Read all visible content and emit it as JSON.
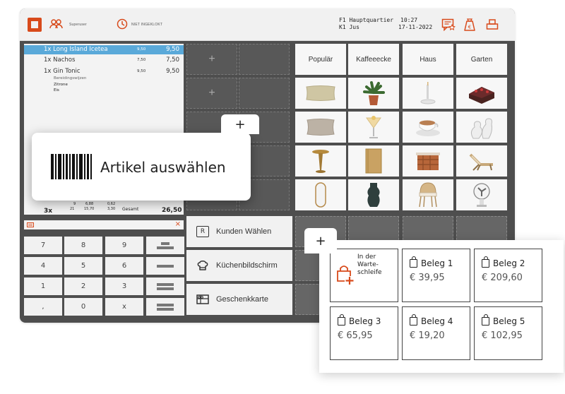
{
  "topbar": {
    "user_label": "Superuser",
    "clock_label": "NIET INGEKLOKT",
    "location_line1": "F1 Hauptquartier",
    "location_line2": "K1 Jus",
    "time": "10:27",
    "date": "17-11-2022"
  },
  "order": {
    "items": [
      {
        "qty": "1x",
        "name": "Long Island Icetea",
        "price": "9,50",
        "total": "9,50",
        "selected": true
      },
      {
        "qty": "1x",
        "name": "Nachos",
        "price": "7,50",
        "total": "7,50",
        "selected": false
      },
      {
        "qty": "1x",
        "name": "Gin Tonic",
        "price": "9,50",
        "total": "9,50",
        "selected": false
      }
    ],
    "modifier_caption": "Bereidingswijzen",
    "modifiers": [
      "Zitrone",
      "Eis"
    ],
    "summary": {
      "count": "3x",
      "col1_top": "9",
      "col1_bottom": "21",
      "col2_top": "6,88",
      "col2_bottom": "15,70",
      "col3_top": "0,62",
      "col3_bottom": "3,30",
      "total_label": "Gesamt",
      "total": "26,50"
    }
  },
  "keypad": {
    "keys": [
      "7",
      "8",
      "9",
      "4",
      "5",
      "6",
      "1",
      "2",
      "3",
      ",",
      "0",
      "x"
    ]
  },
  "actions": [
    {
      "label": "Kunden Wählen",
      "icon": "customer-icon"
    },
    {
      "label": "Küchenbildschirm",
      "icon": "chef-hat-icon"
    },
    {
      "label": "Geschenkkarte",
      "icon": "gift-card-icon"
    }
  ],
  "categories": [
    "Populär",
    "Kaffeeecke",
    "Haus",
    "Garten"
  ],
  "products": [
    "pillow",
    "plant",
    "candle-holder",
    "cake",
    "cushion",
    "cocktail",
    "coffee-cup",
    "vase",
    "side-table",
    "book",
    "basket",
    "lounge-chair",
    "mirror",
    "black-vase",
    "rattan-chair",
    "fan"
  ],
  "artikel": {
    "label": "Artikel auswählen"
  },
  "receipts": {
    "waiting_label": "In der Warte-schleife",
    "items": [
      {
        "title": "Beleg 1",
        "amount": "€ 39,95"
      },
      {
        "title": "Beleg 2",
        "amount": "€ 209,60"
      },
      {
        "title": "Beleg 3",
        "amount": "€ 65,95"
      },
      {
        "title": "Beleg 4",
        "amount": "€ 19,20"
      },
      {
        "title": "Beleg 5",
        "amount": "€ 102,95"
      }
    ]
  },
  "colors": {
    "accent": "#d84a1b",
    "selected_row": "#5aa9d9",
    "app_bg": "#4e4e4e"
  },
  "plus": "+"
}
